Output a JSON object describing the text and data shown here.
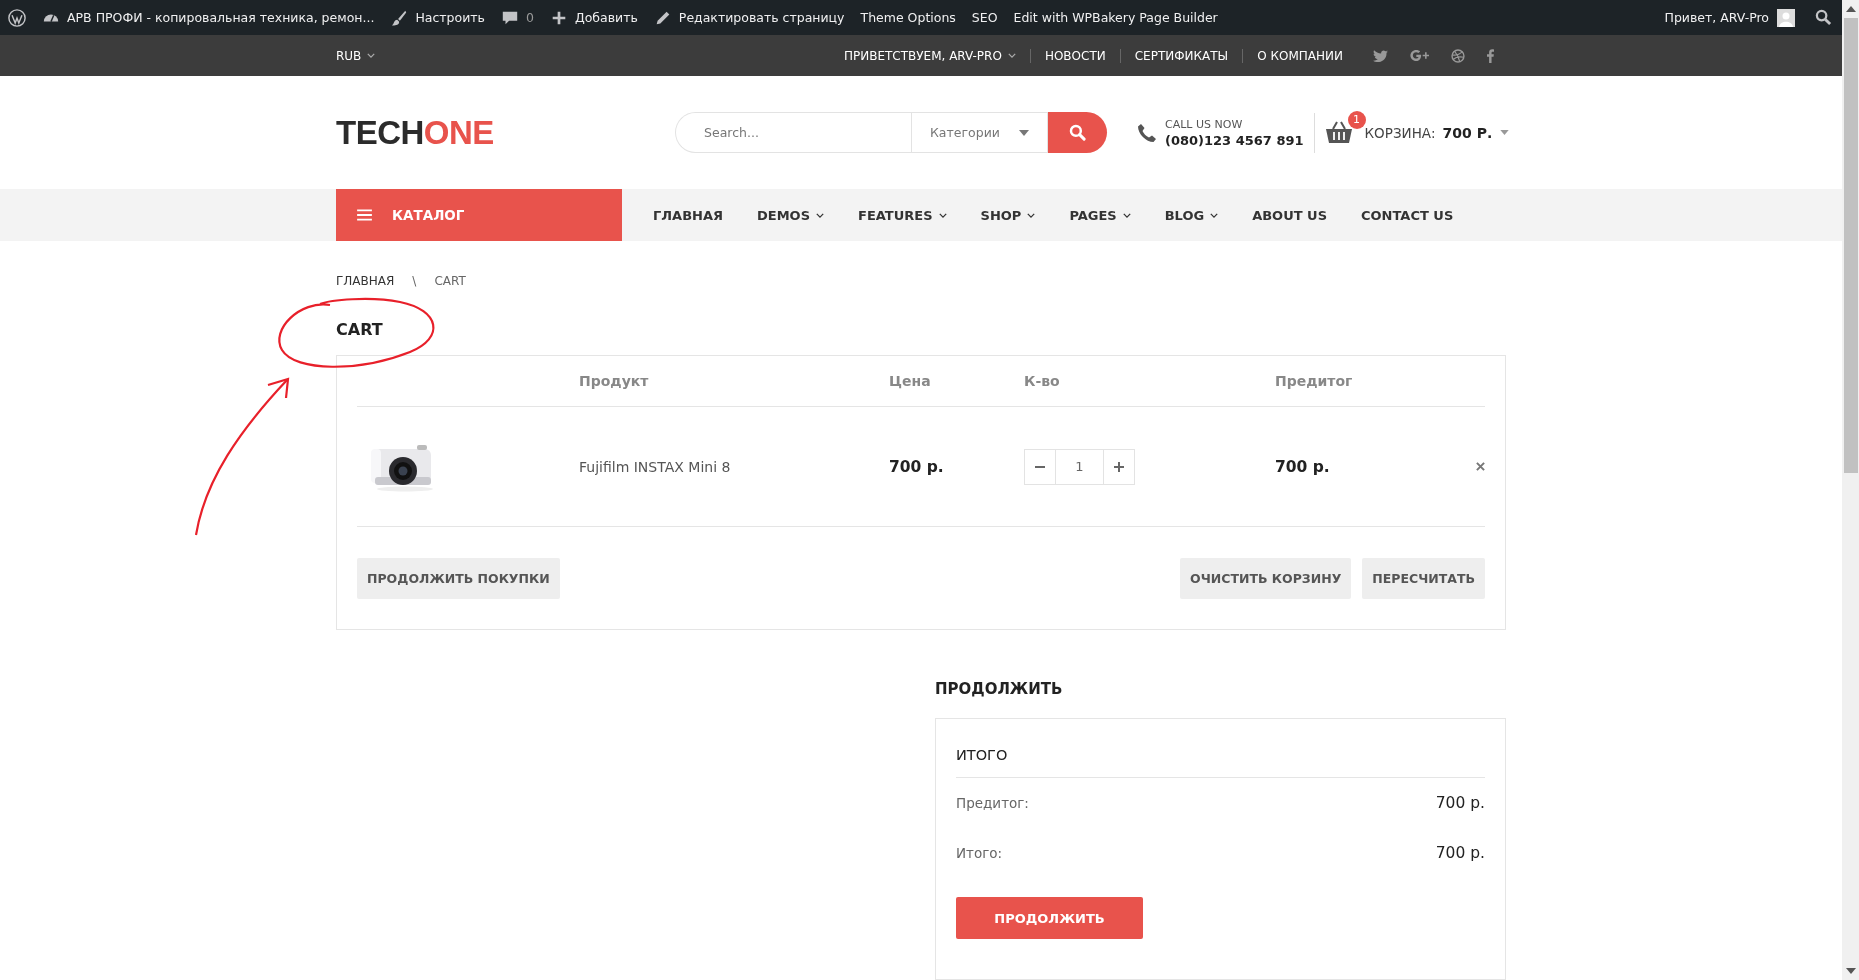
{
  "admin_bar": {
    "items": [
      {
        "kind": "wp-logo"
      },
      {
        "kind": "site",
        "label": "АРВ ПРОФИ - копировальная техника, ремон..."
      },
      {
        "kind": "customize",
        "label": "Настроить"
      },
      {
        "kind": "comments",
        "label": "0"
      },
      {
        "kind": "new",
        "label": "Добавить"
      },
      {
        "kind": "edit",
        "label": "Редактировать страницу"
      },
      {
        "kind": "text",
        "label": "Theme Options"
      },
      {
        "kind": "text",
        "label": "SEO"
      },
      {
        "kind": "text",
        "label": "Edit with WPBakery Page Builder"
      }
    ],
    "greeting": "Привет, ARV-Pro"
  },
  "top_bar": {
    "currency": "RUB",
    "links": [
      {
        "label": "ПРИВЕТСТВУЕМ, ARV-PRO",
        "dropdown": true
      },
      {
        "label": "НОВОСТИ",
        "dropdown": false
      },
      {
        "label": "СЕРТИФИКАТЫ",
        "dropdown": false
      },
      {
        "label": "О КОМПАНИИ",
        "dropdown": false
      }
    ],
    "social": [
      {
        "kind": "twitter"
      },
      {
        "kind": "google-plus"
      },
      {
        "kind": "dribbble"
      },
      {
        "kind": "facebook"
      }
    ]
  },
  "header": {
    "logo": {
      "dark": "TECH",
      "accent": "ONE"
    },
    "search": {
      "placeholder": "Search..."
    },
    "category": "Категории",
    "phone_label": "CALL US NOW",
    "phone": "(080)123 4567 891",
    "cart_count": "1",
    "cart_label": "КОРЗИНА:",
    "cart_total": "700 Р."
  },
  "nav": {
    "catalog": "КАТАЛОГ",
    "items": [
      {
        "label": "ГЛАВНАЯ",
        "dropdown": false
      },
      {
        "label": "DEMOS",
        "dropdown": true
      },
      {
        "label": "FEATURES",
        "dropdown": true
      },
      {
        "label": "SHOP",
        "dropdown": true
      },
      {
        "label": "PAGES",
        "dropdown": true
      },
      {
        "label": "BLOG",
        "dropdown": true
      },
      {
        "label": "ABOUT US",
        "dropdown": false
      },
      {
        "label": "CONTACT US",
        "dropdown": false
      }
    ]
  },
  "breadcrumb": {
    "items": [
      "ГЛАВНАЯ",
      "CART"
    ],
    "separator": "\\"
  },
  "page_title": "CART",
  "cart": {
    "columns": [
      "Продукт",
      "Цена",
      "К-во",
      "Предитог"
    ],
    "rows": [
      {
        "product": "Fujifilm INSTAX Mini 8",
        "price": "700 р.",
        "quantity": "1",
        "subtotal": "700 р."
      }
    ],
    "continue_button": "ПРОДОЛЖИТЬ ПОКУПКИ",
    "clear_button": "ОЧИСТИТЬ КОРЗИНУ",
    "update_button": "ПЕРЕСЧИТАТЬ"
  },
  "totals": {
    "heading": "ПРОДОЛЖИТЬ",
    "title": "ИТОГО",
    "rows": [
      {
        "label": "Предитог:",
        "value": "700 р."
      },
      {
        "label": "Итого:",
        "value": "700 р."
      }
    ],
    "button": "ПРОДОЛЖИТЬ"
  }
}
